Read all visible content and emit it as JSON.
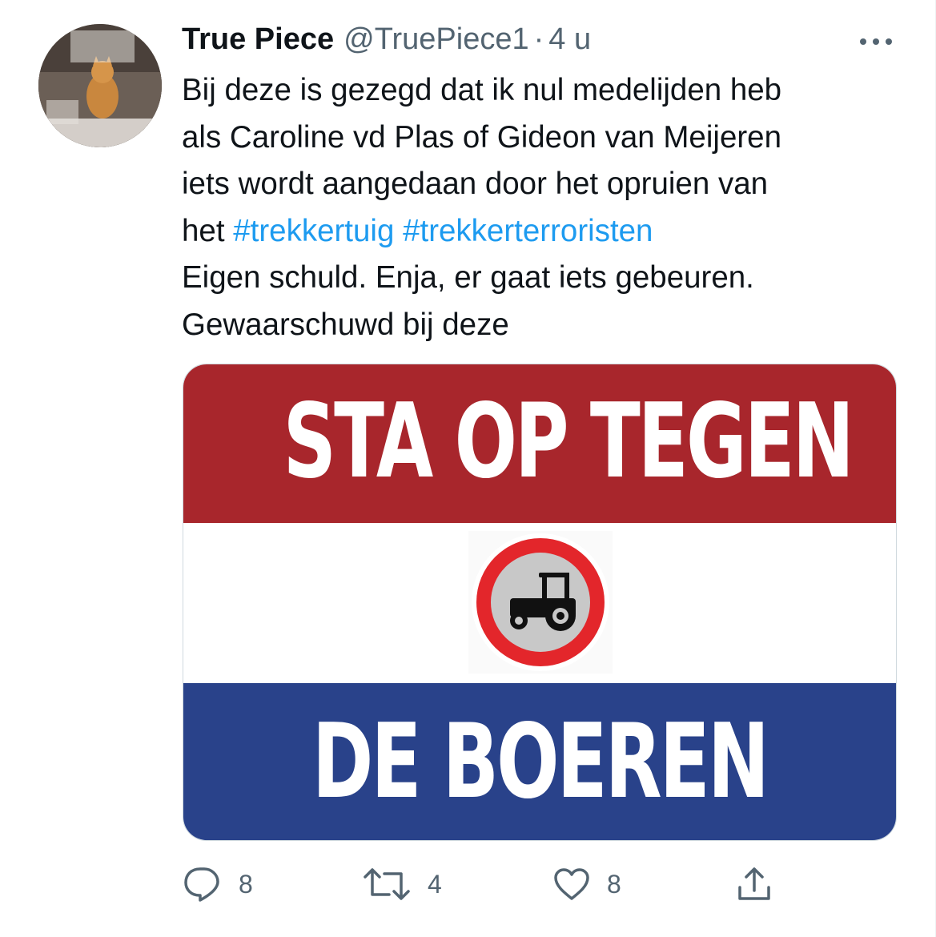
{
  "tweet": {
    "display_name": "True Piece",
    "handle": "@TruePiece1",
    "separator": "·",
    "time": "4 u",
    "text_lines": [
      "Bij deze is gezegd dat ik nul medelijden heb",
      "als Caroline vd Plas of Gideon van Meijeren",
      "iets wordt aangedaan door het opruien van"
    ],
    "line4_prefix": "het",
    "hashtags": [
      "#trekkertuig",
      "#trekkerterroristen"
    ],
    "line5": "Eigen schuld. Enja, er gaat iets gebeuren.",
    "line6": "Gewaarschuwd bij deze"
  },
  "avatar": {
    "icon": "cat-photo-avatar"
  },
  "media": {
    "top_text": "STA OP TEGEN",
    "bottom_text": "DE BOEREN",
    "sign_icon": "no-tractors-sign-icon",
    "colors": {
      "red": "#a8262c",
      "white": "#ffffff",
      "blue": "#29428a"
    }
  },
  "actions": {
    "reply_count": "8",
    "retweet_count": "4",
    "like_count": "8"
  },
  "colors": {
    "hashtag": "#1d9bf0",
    "muted": "#536471",
    "text": "#0f1419"
  }
}
